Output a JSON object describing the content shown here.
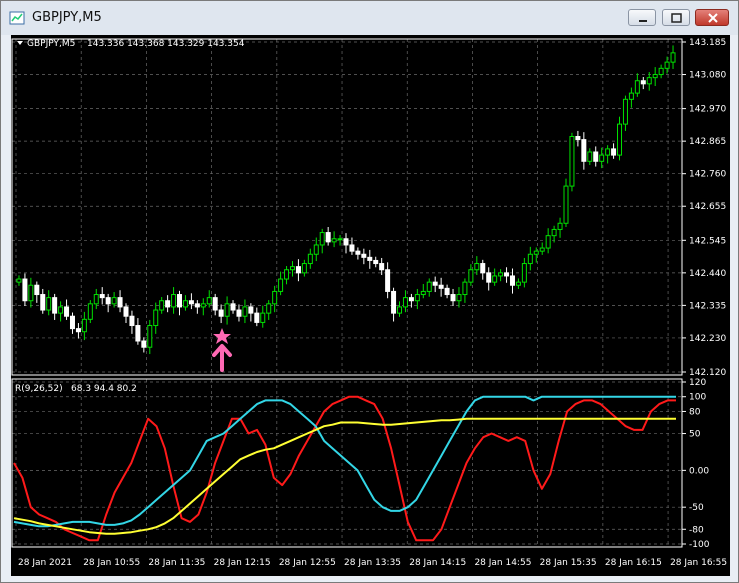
{
  "window": {
    "title": "GBPJPY,M5"
  },
  "header": {
    "symbol_label": "GBPJPY,M5",
    "ohlc": "143.336 143.368 143.329 143.354"
  },
  "indicator": {
    "label": "R(9,26,52)",
    "values": "68.3 94.4 80.2"
  },
  "colors": {
    "background": "#000000",
    "grid": "#6a6a6a",
    "bull": "#00e000",
    "bear": "#ffffff",
    "red_line": "#ff1a1a",
    "cyan_line": "#33d6e6",
    "yellow_line": "#ffff33",
    "arrow": "#ff69b4"
  },
  "markers": [
    {
      "type": "star-icon",
      "bar": 40
    },
    {
      "type": "arrow-up-icon",
      "bar": 40
    }
  ],
  "chart_data": [
    {
      "type": "candlestick",
      "ylim": [
        142.12,
        143.185
      ],
      "y_ticks": [
        "143.185",
        "143.080",
        "142.970",
        "142.865",
        "142.760",
        "142.655",
        "142.545",
        "142.440",
        "142.335",
        "142.230",
        "142.120"
      ],
      "x_ticks": [
        "28 Jan 2021",
        "28 Jan 10:55",
        "28 Jan 11:35",
        "28 Jan 12:15",
        "28 Jan 12:55",
        "28 Jan 13:35",
        "28 Jan 14:15",
        "28 Jan 14:55",
        "28 Jan 15:35",
        "28 Jan 16:15",
        "28 Jan 16:55"
      ],
      "close": [
        142.42,
        142.35,
        142.4,
        142.37,
        142.32,
        142.36,
        142.31,
        142.33,
        142.3,
        142.26,
        142.25,
        142.29,
        142.34,
        142.37,
        142.36,
        142.34,
        142.36,
        142.33,
        142.3,
        142.27,
        142.22,
        142.2,
        142.27,
        142.32,
        142.35,
        142.33,
        142.37,
        142.33,
        142.35,
        142.34,
        142.33,
        142.34,
        142.36,
        142.32,
        142.3,
        142.34,
        142.32,
        142.3,
        142.33,
        142.31,
        142.28,
        142.31,
        142.34,
        142.38,
        142.42,
        142.45,
        142.46,
        142.44,
        142.47,
        142.5,
        142.53,
        142.57,
        142.54,
        142.55,
        142.55,
        142.53,
        142.51,
        142.5,
        142.49,
        142.48,
        142.47,
        142.45,
        142.38,
        142.31,
        142.33,
        142.36,
        142.35,
        142.37,
        142.38,
        142.41,
        142.4,
        142.39,
        142.37,
        142.35,
        142.37,
        142.41,
        142.45,
        142.47,
        142.44,
        142.41,
        142.43,
        142.44,
        142.43,
        142.4,
        142.41,
        142.47,
        142.5,
        142.51,
        142.52,
        142.56,
        142.58,
        142.6,
        142.72,
        142.88,
        142.87,
        142.8,
        142.83,
        142.8,
        142.82,
        142.84,
        142.82,
        142.92,
        143.0,
        143.02,
        143.06,
        143.05,
        143.07,
        143.08,
        143.1,
        143.12,
        143.15
      ],
      "yline": 142.32
    },
    {
      "type": "line",
      "ylim": [
        -100,
        120
      ],
      "y_ticks": [
        "120",
        "100",
        "80",
        "50",
        "0.00",
        "-50",
        "-80",
        "-100"
      ],
      "series": [
        {
          "color": "red",
          "values": [
            10,
            -10,
            -50,
            -60,
            -65,
            -70,
            -80,
            -85,
            -90,
            -95,
            -95,
            -60,
            -30,
            -10,
            10,
            40,
            70,
            60,
            30,
            -20,
            -65,
            -70,
            -60,
            -30,
            10,
            40,
            70,
            70,
            50,
            55,
            35,
            -10,
            -20,
            -5,
            20,
            40,
            60,
            80,
            90,
            95,
            100,
            100,
            95,
            90,
            70,
            30,
            -20,
            -70,
            -95,
            -95,
            -95,
            -80,
            -50,
            -20,
            10,
            30,
            45,
            50,
            45,
            40,
            45,
            40,
            0,
            -25,
            -5,
            40,
            80,
            90,
            95,
            95,
            90,
            80,
            70,
            60,
            55,
            55,
            80,
            90,
            95,
            95
          ]
        },
        {
          "color": "cyan",
          "values": [
            -70,
            -72,
            -74,
            -76,
            -76,
            -74,
            -72,
            -70,
            -70,
            -70,
            -72,
            -74,
            -74,
            -72,
            -68,
            -60,
            -50,
            -40,
            -30,
            -20,
            -10,
            0,
            20,
            40,
            45,
            50,
            60,
            70,
            80,
            90,
            95,
            95,
            95,
            90,
            80,
            70,
            60,
            40,
            30,
            20,
            10,
            0,
            -20,
            -40,
            -50,
            -55,
            -55,
            -50,
            -40,
            -20,
            0,
            20,
            40,
            60,
            80,
            95,
            100,
            100,
            100,
            100,
            100,
            100,
            95,
            100,
            100,
            100,
            100,
            100,
            100,
            100,
            100,
            100,
            100,
            100,
            100,
            100,
            100,
            100,
            100,
            100
          ]
        },
        {
          "color": "yellow",
          "values": [
            -65,
            -67,
            -69,
            -72,
            -74,
            -76,
            -78,
            -80,
            -82,
            -84,
            -85,
            -86,
            -86,
            -85,
            -84,
            -82,
            -80,
            -77,
            -72,
            -65,
            -55,
            -45,
            -35,
            -25,
            -15,
            -5,
            5,
            15,
            20,
            25,
            28,
            30,
            35,
            40,
            45,
            50,
            55,
            60,
            62,
            65,
            65,
            65,
            64,
            63,
            62,
            62,
            63,
            64,
            65,
            66,
            67,
            68,
            68,
            69,
            70,
            70,
            70,
            70,
            70,
            70,
            70,
            70,
            70,
            70,
            70,
            70,
            70,
            70,
            70,
            70,
            70,
            70,
            70,
            70,
            70,
            70,
            70,
            70,
            70,
            70
          ]
        }
      ]
    }
  ]
}
